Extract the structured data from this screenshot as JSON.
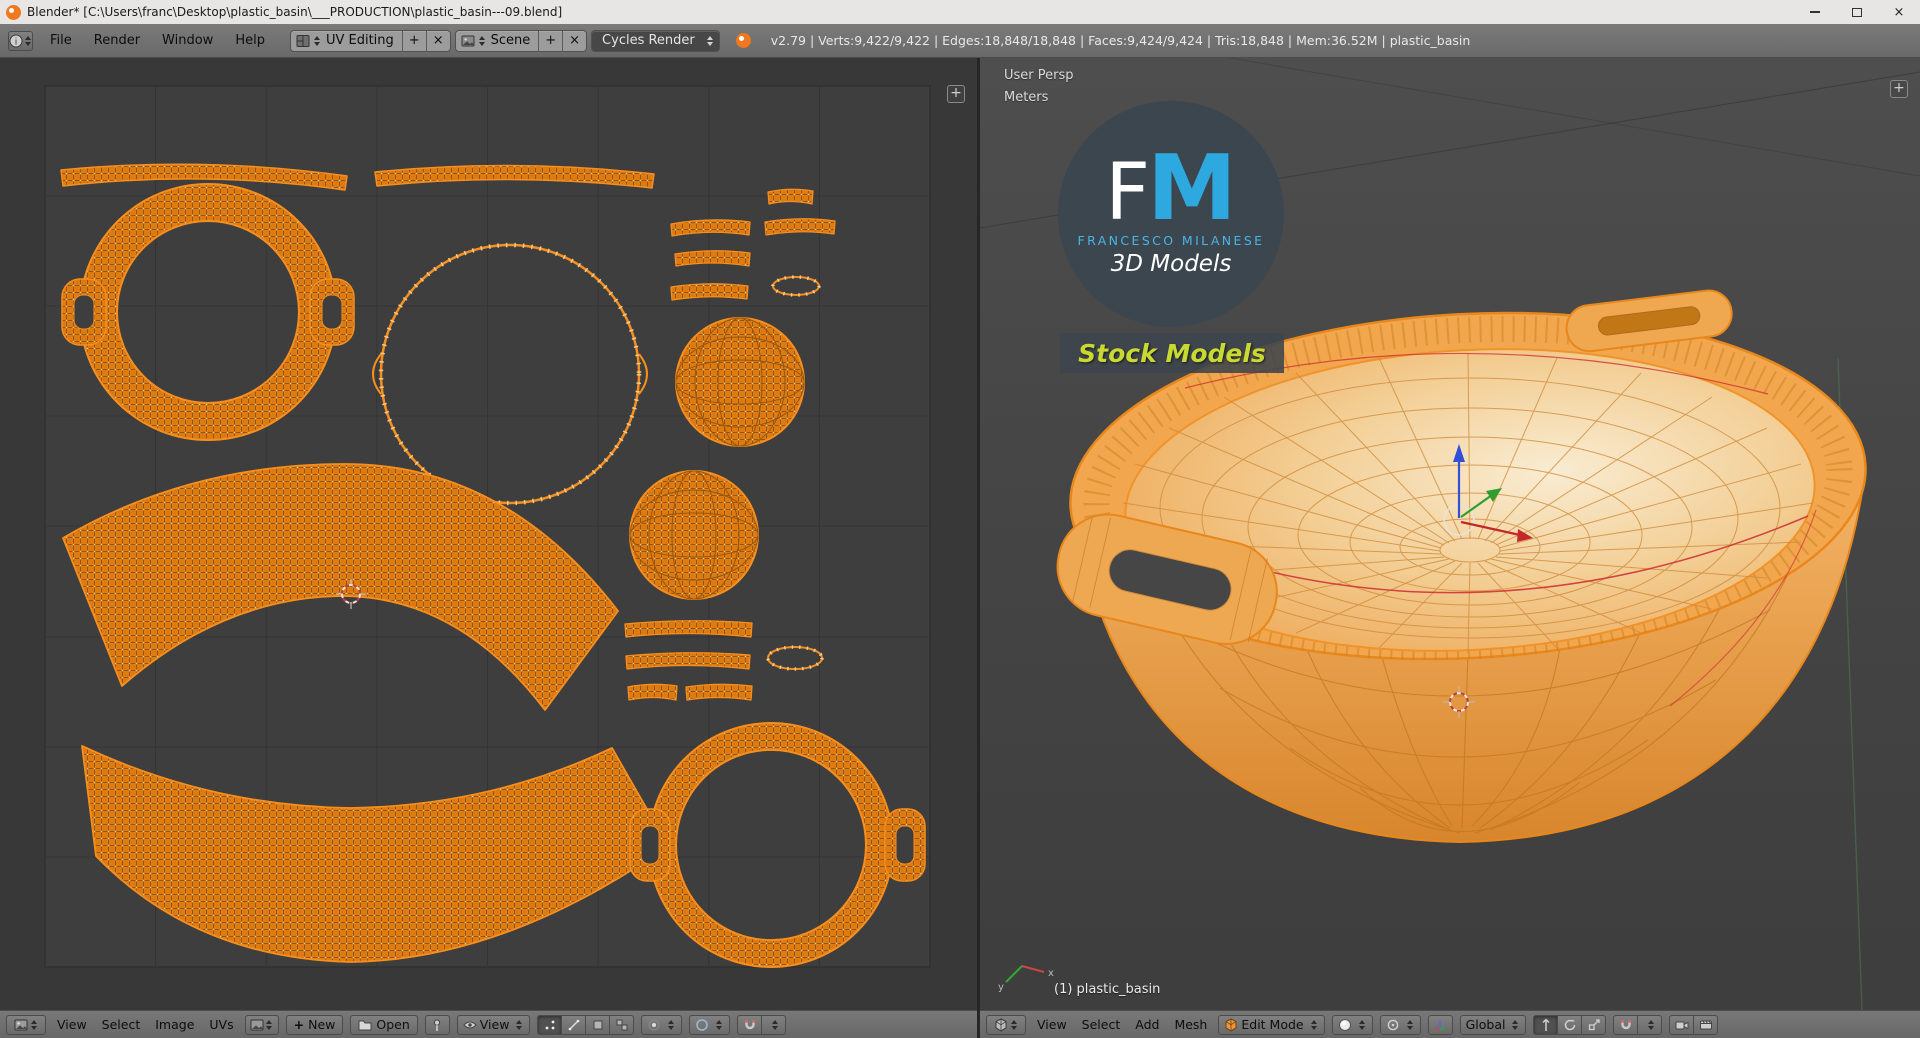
{
  "window": {
    "title": "Blender* [C:\\Users\\franc\\Desktop\\plastic_basin\\___PRODUCTION\\plastic_basin---09.blend]"
  },
  "infobar": {
    "menus": [
      "File",
      "Render",
      "Window",
      "Help"
    ],
    "layout_value": "UV Editing",
    "scene_value": "Scene",
    "engine_value": "Cycles Render",
    "stats": "v2.79 | Verts:9,422/9,422 | Edges:18,848/18,848 | Faces:9,424/9,424 | Tris:18,848 | Mem:36.52M | plastic_basin"
  },
  "uv_editor": {
    "header": {
      "menus": [
        "View",
        "Select",
        "Image",
        "UVs"
      ],
      "new_button": "New",
      "open_button": "Open",
      "view_mode": "View"
    }
  },
  "viewport3d": {
    "overlay": {
      "persp": "User Persp",
      "units": "Meters",
      "object_info": "(1) plastic_basin"
    },
    "header": {
      "menus": [
        "View",
        "Select",
        "Add",
        "Mesh"
      ],
      "mode": "Edit Mode",
      "orientation": "Global"
    }
  },
  "watermark": {
    "initials_f": "F",
    "initials_m": "M",
    "name": "FRANCESCO MILANESE",
    "brand": "3D Models",
    "stock": "Stock Models"
  },
  "colors": {
    "selection_orange": "#f78f1e",
    "uv_mesh_fill": "#dd7a12",
    "bowl_highlight": "#f9ecd2",
    "axis_x": "#c42828",
    "axis_y": "#2f9e2f",
    "axis_z": "#3050d8",
    "fm_blue": "#2ea9e0",
    "stock_text": "#c8d932",
    "header_gray": "#6e6e6e"
  }
}
